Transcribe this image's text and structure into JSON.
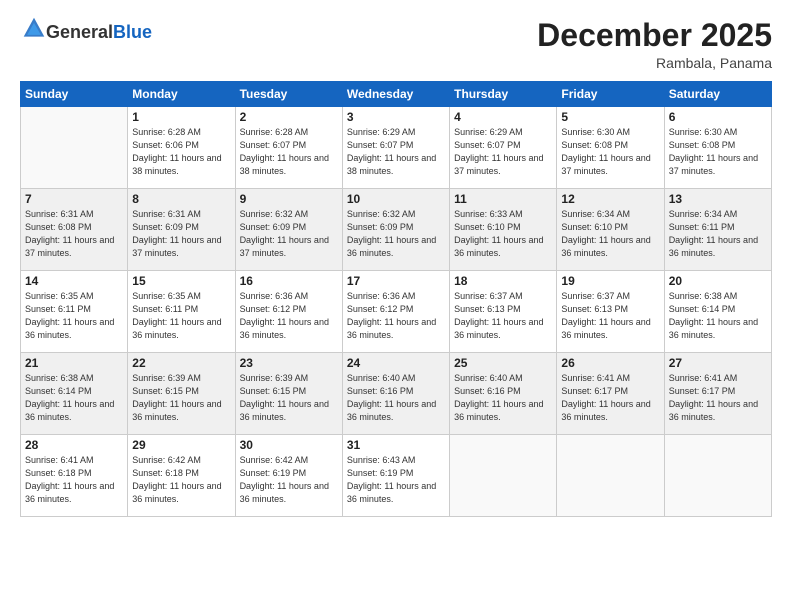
{
  "logo": {
    "general": "General",
    "blue": "Blue"
  },
  "title": "December 2025",
  "subtitle": "Rambala, Panama",
  "header_days": [
    "Sunday",
    "Monday",
    "Tuesday",
    "Wednesday",
    "Thursday",
    "Friday",
    "Saturday"
  ],
  "weeks": [
    [
      {
        "day": "",
        "sunrise": "",
        "sunset": "",
        "daylight": "",
        "empty": true
      },
      {
        "day": "1",
        "sunrise": "Sunrise: 6:28 AM",
        "sunset": "Sunset: 6:06 PM",
        "daylight": "Daylight: 11 hours and 38 minutes."
      },
      {
        "day": "2",
        "sunrise": "Sunrise: 6:28 AM",
        "sunset": "Sunset: 6:07 PM",
        "daylight": "Daylight: 11 hours and 38 minutes."
      },
      {
        "day": "3",
        "sunrise": "Sunrise: 6:29 AM",
        "sunset": "Sunset: 6:07 PM",
        "daylight": "Daylight: 11 hours and 38 minutes."
      },
      {
        "day": "4",
        "sunrise": "Sunrise: 6:29 AM",
        "sunset": "Sunset: 6:07 PM",
        "daylight": "Daylight: 11 hours and 37 minutes."
      },
      {
        "day": "5",
        "sunrise": "Sunrise: 6:30 AM",
        "sunset": "Sunset: 6:08 PM",
        "daylight": "Daylight: 11 hours and 37 minutes."
      },
      {
        "day": "6",
        "sunrise": "Sunrise: 6:30 AM",
        "sunset": "Sunset: 6:08 PM",
        "daylight": "Daylight: 11 hours and 37 minutes."
      }
    ],
    [
      {
        "day": "7",
        "sunrise": "Sunrise: 6:31 AM",
        "sunset": "Sunset: 6:08 PM",
        "daylight": "Daylight: 11 hours and 37 minutes."
      },
      {
        "day": "8",
        "sunrise": "Sunrise: 6:31 AM",
        "sunset": "Sunset: 6:09 PM",
        "daylight": "Daylight: 11 hours and 37 minutes."
      },
      {
        "day": "9",
        "sunrise": "Sunrise: 6:32 AM",
        "sunset": "Sunset: 6:09 PM",
        "daylight": "Daylight: 11 hours and 37 minutes."
      },
      {
        "day": "10",
        "sunrise": "Sunrise: 6:32 AM",
        "sunset": "Sunset: 6:09 PM",
        "daylight": "Daylight: 11 hours and 36 minutes."
      },
      {
        "day": "11",
        "sunrise": "Sunrise: 6:33 AM",
        "sunset": "Sunset: 6:10 PM",
        "daylight": "Daylight: 11 hours and 36 minutes."
      },
      {
        "day": "12",
        "sunrise": "Sunrise: 6:34 AM",
        "sunset": "Sunset: 6:10 PM",
        "daylight": "Daylight: 11 hours and 36 minutes."
      },
      {
        "day": "13",
        "sunrise": "Sunrise: 6:34 AM",
        "sunset": "Sunset: 6:11 PM",
        "daylight": "Daylight: 11 hours and 36 minutes."
      }
    ],
    [
      {
        "day": "14",
        "sunrise": "Sunrise: 6:35 AM",
        "sunset": "Sunset: 6:11 PM",
        "daylight": "Daylight: 11 hours and 36 minutes."
      },
      {
        "day": "15",
        "sunrise": "Sunrise: 6:35 AM",
        "sunset": "Sunset: 6:11 PM",
        "daylight": "Daylight: 11 hours and 36 minutes."
      },
      {
        "day": "16",
        "sunrise": "Sunrise: 6:36 AM",
        "sunset": "Sunset: 6:12 PM",
        "daylight": "Daylight: 11 hours and 36 minutes."
      },
      {
        "day": "17",
        "sunrise": "Sunrise: 6:36 AM",
        "sunset": "Sunset: 6:12 PM",
        "daylight": "Daylight: 11 hours and 36 minutes."
      },
      {
        "day": "18",
        "sunrise": "Sunrise: 6:37 AM",
        "sunset": "Sunset: 6:13 PM",
        "daylight": "Daylight: 11 hours and 36 minutes."
      },
      {
        "day": "19",
        "sunrise": "Sunrise: 6:37 AM",
        "sunset": "Sunset: 6:13 PM",
        "daylight": "Daylight: 11 hours and 36 minutes."
      },
      {
        "day": "20",
        "sunrise": "Sunrise: 6:38 AM",
        "sunset": "Sunset: 6:14 PM",
        "daylight": "Daylight: 11 hours and 36 minutes."
      }
    ],
    [
      {
        "day": "21",
        "sunrise": "Sunrise: 6:38 AM",
        "sunset": "Sunset: 6:14 PM",
        "daylight": "Daylight: 11 hours and 36 minutes."
      },
      {
        "day": "22",
        "sunrise": "Sunrise: 6:39 AM",
        "sunset": "Sunset: 6:15 PM",
        "daylight": "Daylight: 11 hours and 36 minutes."
      },
      {
        "day": "23",
        "sunrise": "Sunrise: 6:39 AM",
        "sunset": "Sunset: 6:15 PM",
        "daylight": "Daylight: 11 hours and 36 minutes."
      },
      {
        "day": "24",
        "sunrise": "Sunrise: 6:40 AM",
        "sunset": "Sunset: 6:16 PM",
        "daylight": "Daylight: 11 hours and 36 minutes."
      },
      {
        "day": "25",
        "sunrise": "Sunrise: 6:40 AM",
        "sunset": "Sunset: 6:16 PM",
        "daylight": "Daylight: 11 hours and 36 minutes."
      },
      {
        "day": "26",
        "sunrise": "Sunrise: 6:41 AM",
        "sunset": "Sunset: 6:17 PM",
        "daylight": "Daylight: 11 hours and 36 minutes."
      },
      {
        "day": "27",
        "sunrise": "Sunrise: 6:41 AM",
        "sunset": "Sunset: 6:17 PM",
        "daylight": "Daylight: 11 hours and 36 minutes."
      }
    ],
    [
      {
        "day": "28",
        "sunrise": "Sunrise: 6:41 AM",
        "sunset": "Sunset: 6:18 PM",
        "daylight": "Daylight: 11 hours and 36 minutes."
      },
      {
        "day": "29",
        "sunrise": "Sunrise: 6:42 AM",
        "sunset": "Sunset: 6:18 PM",
        "daylight": "Daylight: 11 hours and 36 minutes."
      },
      {
        "day": "30",
        "sunrise": "Sunrise: 6:42 AM",
        "sunset": "Sunset: 6:19 PM",
        "daylight": "Daylight: 11 hours and 36 minutes."
      },
      {
        "day": "31",
        "sunrise": "Sunrise: 6:43 AM",
        "sunset": "Sunset: 6:19 PM",
        "daylight": "Daylight: 11 hours and 36 minutes."
      },
      {
        "day": "",
        "sunrise": "",
        "sunset": "",
        "daylight": "",
        "empty": true
      },
      {
        "day": "",
        "sunrise": "",
        "sunset": "",
        "daylight": "",
        "empty": true
      },
      {
        "day": "",
        "sunrise": "",
        "sunset": "",
        "daylight": "",
        "empty": true
      }
    ]
  ]
}
